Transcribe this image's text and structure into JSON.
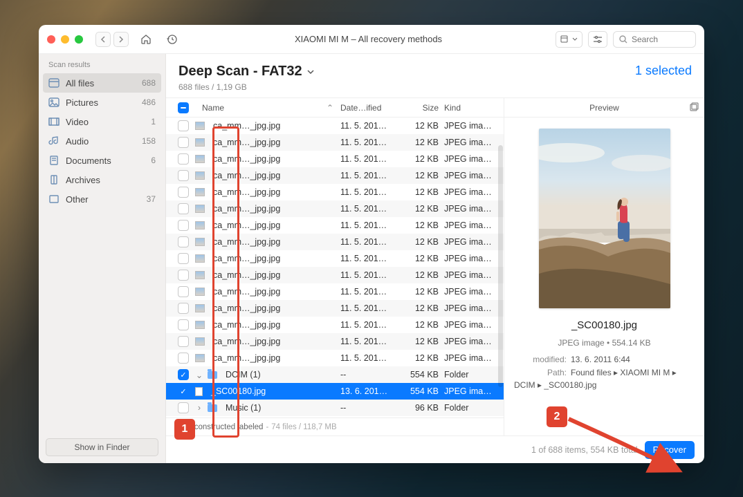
{
  "window": {
    "title": "XIAOMI MI M – All recovery methods",
    "search_placeholder": "Search"
  },
  "sidebar": {
    "heading": "Scan results",
    "items": [
      {
        "label": "All files",
        "count": "688"
      },
      {
        "label": "Pictures",
        "count": "486"
      },
      {
        "label": "Video",
        "count": "1"
      },
      {
        "label": "Audio",
        "count": "158"
      },
      {
        "label": "Documents",
        "count": "6"
      },
      {
        "label": "Archives",
        "count": ""
      },
      {
        "label": "Other",
        "count": "37"
      }
    ],
    "show_in_finder": "Show in Finder"
  },
  "main": {
    "heading": "Deep Scan - FAT32",
    "subheading": "688 files / 1,19 GB",
    "selected_label": "1 selected",
    "columns": {
      "name": "Name",
      "date": "Date…ified",
      "size": "Size",
      "kind": "Kind"
    },
    "rows": [
      {
        "name": "ca_mm…_jpg.jpg",
        "date": "11. 5. 201…",
        "size": "12 KB",
        "kind": "JPEG ima…",
        "type": "img"
      },
      {
        "name": "ca_mm…_jpg.jpg",
        "date": "11. 5. 201…",
        "size": "12 KB",
        "kind": "JPEG ima…",
        "type": "img"
      },
      {
        "name": "ca_mm…_jpg.jpg",
        "date": "11. 5. 201…",
        "size": "12 KB",
        "kind": "JPEG ima…",
        "type": "img"
      },
      {
        "name": "ca_mm…_jpg.jpg",
        "date": "11. 5. 201…",
        "size": "12 KB",
        "kind": "JPEG ima…",
        "type": "img"
      },
      {
        "name": "ca_mm…_jpg.jpg",
        "date": "11. 5. 201…",
        "size": "12 KB",
        "kind": "JPEG ima…",
        "type": "img"
      },
      {
        "name": "ca_mm…_jpg.jpg",
        "date": "11. 5. 201…",
        "size": "12 KB",
        "kind": "JPEG ima…",
        "type": "img"
      },
      {
        "name": "ca_mm…_jpg.jpg",
        "date": "11. 5. 201…",
        "size": "12 KB",
        "kind": "JPEG ima…",
        "type": "img"
      },
      {
        "name": "ca_mm…_jpg.jpg",
        "date": "11. 5. 201…",
        "size": "12 KB",
        "kind": "JPEG ima…",
        "type": "img"
      },
      {
        "name": "ca_mm…_jpg.jpg",
        "date": "11. 5. 201…",
        "size": "12 KB",
        "kind": "JPEG ima…",
        "type": "img"
      },
      {
        "name": "ca_mm…_jpg.jpg",
        "date": "11. 5. 201…",
        "size": "12 KB",
        "kind": "JPEG ima…",
        "type": "img"
      },
      {
        "name": "ca_mm…_jpg.jpg",
        "date": "11. 5. 201…",
        "size": "12 KB",
        "kind": "JPEG ima…",
        "type": "img"
      },
      {
        "name": "ca_mm…_jpg.jpg",
        "date": "11. 5. 201…",
        "size": "12 KB",
        "kind": "JPEG ima…",
        "type": "img"
      },
      {
        "name": "ca_mm…_jpg.jpg",
        "date": "11. 5. 201…",
        "size": "12 KB",
        "kind": "JPEG ima…",
        "type": "img"
      },
      {
        "name": "ca_mm…_jpg.jpg",
        "date": "11. 5. 201…",
        "size": "12 KB",
        "kind": "JPEG ima…",
        "type": "img"
      },
      {
        "name": "ca_mm…_jpg.jpg",
        "date": "11. 5. 201…",
        "size": "12 KB",
        "kind": "JPEG ima…",
        "type": "img"
      },
      {
        "name": "DCIM (1)",
        "date": "--",
        "size": "554 KB",
        "kind": "Folder",
        "type": "folder",
        "open": true,
        "checked": true
      },
      {
        "name": "_SC00180.jpg",
        "date": "13. 6. 201…",
        "size": "554 KB",
        "kind": "JPEG ima…",
        "type": "file",
        "indent": 2,
        "checked": true,
        "selected": true
      },
      {
        "name": "Music (1)",
        "date": "--",
        "size": "96 KB",
        "kind": "Folder",
        "type": "folder",
        "open": false,
        "indent": 1
      }
    ],
    "breadcrumb": "Reconstructed labeled",
    "breadcrumb_meta": "74 files / 118,7 MB"
  },
  "preview": {
    "heading": "Preview",
    "filename": "_SC00180.jpg",
    "meta": "JPEG image • 554.14 KB",
    "modified_k": "modified:",
    "modified_v": "13. 6. 2011 6:44",
    "path_k": "Path:",
    "path_v": "Found files ▸ XIAOMI MI M ▸ DCIM ▸ _SC00180.jpg"
  },
  "footer": {
    "info": "1 of 688 items, 554 KB total",
    "recover": "Recover"
  },
  "annot": {
    "b1": "1",
    "b2": "2"
  }
}
